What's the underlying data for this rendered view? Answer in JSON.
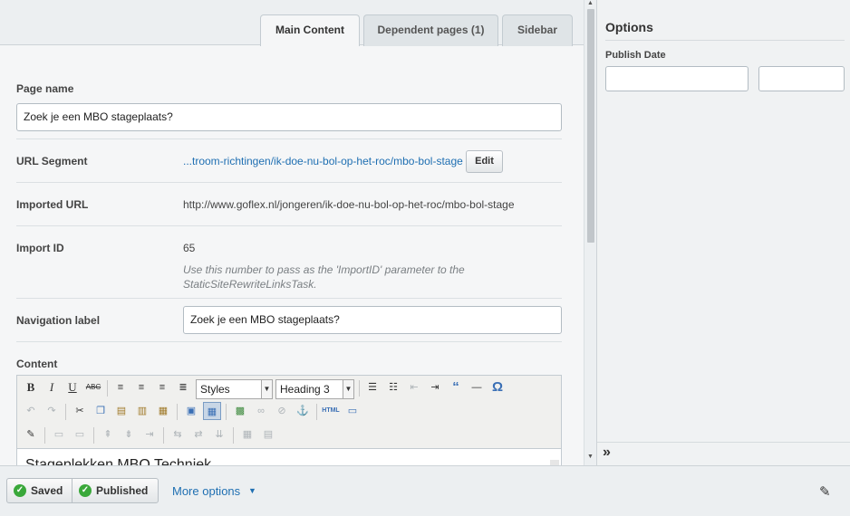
{
  "tabs": [
    {
      "label": "Main Content"
    },
    {
      "label": "Dependent pages (1)"
    },
    {
      "label": "Sidebar"
    }
  ],
  "fields": {
    "page_name": {
      "label": "Page name",
      "value": "Zoek je een MBO stageplaats?"
    },
    "url_segment": {
      "label": "URL Segment",
      "value": "...troom-richtingen/ik-doe-nu-bol-op-het-roc/mbo-bol-stage",
      "edit_label": "Edit"
    },
    "imported_url": {
      "label": "Imported URL",
      "value": "http://www.goflex.nl/jongeren/ik-doe-nu-bol-op-het-roc/mbo-bol-stage"
    },
    "import_id": {
      "label": "Import ID",
      "value": "65",
      "help": "Use this number to pass as the 'ImportID' parameter to the StaticSiteRewriteLinksTask."
    },
    "navigation_label": {
      "label": "Navigation label",
      "value": "Zoek je een MBO stageplaats?"
    },
    "content": {
      "label": "Content"
    }
  },
  "editor": {
    "toolbar": {
      "bold": "B",
      "italic": "I",
      "underline": "U",
      "strike": "ABC",
      "styles_select": "Styles",
      "format_select": "Heading 3",
      "html_label": "HTML",
      "omega": "Ω"
    },
    "body_heading": "Stageplekken MBO Techniek"
  },
  "sidebar": {
    "title": "Options",
    "publish_date_label": "Publish Date",
    "collapse_glyph": "»"
  },
  "actions": {
    "saved": "Saved",
    "published": "Published",
    "more_options": "More options"
  },
  "icons": {
    "check": "check-icon",
    "caret": "caret-down-icon",
    "preview": "edit-preview-icon"
  }
}
